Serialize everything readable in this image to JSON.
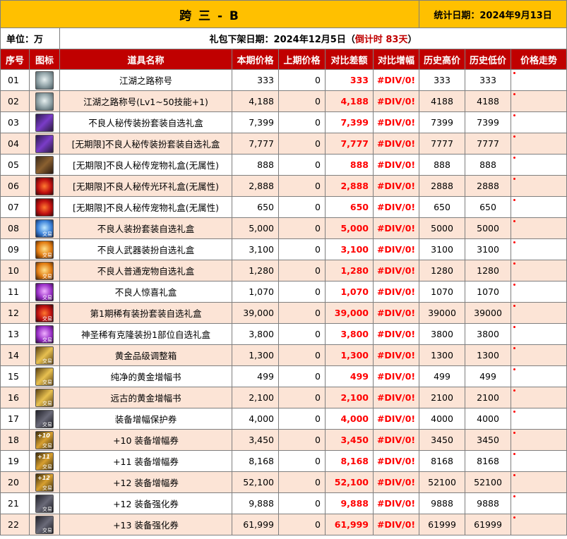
{
  "header": {
    "title": "跨 三 - B",
    "stat_date": "统计日期：2024年9月13日"
  },
  "info": {
    "unit": "单位：万",
    "offline_prefix": "礼包下架日期：2024年12月5日（",
    "countdown": "倒计时 83天",
    "offline_suffix": "）"
  },
  "columns": [
    "序号",
    "图标",
    "道具名称",
    "本期价格",
    "上期价格",
    "对比差额",
    "对比增幅",
    "历史高价",
    "历史低价",
    "价格走势"
  ],
  "rows": [
    {
      "no": "01",
      "icon": "silver-title-icon",
      "style": "ic-silver",
      "tag": "",
      "num": "",
      "name": "江湖之路称号",
      "cur": "333",
      "prev": "0",
      "diff": "333",
      "pct": "#DIV/0!",
      "hi": "333",
      "lo": "333"
    },
    {
      "no": "02",
      "icon": "silver-title-icon",
      "style": "ic-silver",
      "tag": "",
      "num": "",
      "name": "江湖之路称号(Lv1~50技能+1)",
      "cur": "4,188",
      "prev": "0",
      "diff": "4,188",
      "pct": "#DIV/0!",
      "hi": "4188",
      "lo": "4188"
    },
    {
      "no": "03",
      "icon": "purple-box-icon",
      "style": "ic-purple",
      "tag": "",
      "num": "",
      "name": "不良人秘传装扮套装自选礼盒",
      "cur": "7,399",
      "prev": "0",
      "diff": "7,399",
      "pct": "#DIV/0!",
      "hi": "7399",
      "lo": "7399"
    },
    {
      "no": "04",
      "icon": "purple-box-icon",
      "style": "ic-purple",
      "tag": "",
      "num": "",
      "name": "[无期限]不良人秘传装扮套装自选礼盒",
      "cur": "7,777",
      "prev": "0",
      "diff": "7,777",
      "pct": "#DIV/0!",
      "hi": "7777",
      "lo": "7777"
    },
    {
      "no": "05",
      "icon": "brown-box-icon",
      "style": "ic-brown",
      "tag": "",
      "num": "",
      "name": "[无期限]不良人秘传宠物礼盒(无属性)",
      "cur": "888",
      "prev": "0",
      "diff": "888",
      "pct": "#DIV/0!",
      "hi": "888",
      "lo": "888"
    },
    {
      "no": "06",
      "icon": "red-aura-icon",
      "style": "ic-red",
      "tag": "",
      "num": "",
      "name": "[无期限]不良人秘传光环礼盒(无属性)",
      "cur": "2,888",
      "prev": "0",
      "diff": "2,888",
      "pct": "#DIV/0!",
      "hi": "2888",
      "lo": "2888"
    },
    {
      "no": "07",
      "icon": "red-pet-icon",
      "style": "ic-red",
      "tag": "",
      "num": "",
      "name": "[无期限]不良人秘传宠物礼盒(无属性)",
      "cur": "650",
      "prev": "0",
      "diff": "650",
      "pct": "#DIV/0!",
      "hi": "650",
      "lo": "650"
    },
    {
      "no": "08",
      "icon": "blue-box-icon",
      "style": "ic-blue",
      "tag": "交易",
      "num": "",
      "name": "不良人装扮套装自选礼盒",
      "cur": "5,000",
      "prev": "0",
      "diff": "5,000",
      "pct": "#DIV/0!",
      "hi": "5000",
      "lo": "5000"
    },
    {
      "no": "09",
      "icon": "orange-box-icon",
      "style": "ic-orange",
      "tag": "交易",
      "num": "",
      "name": "不良人武器装扮自选礼盒",
      "cur": "3,100",
      "prev": "0",
      "diff": "3,100",
      "pct": "#DIV/0!",
      "hi": "3100",
      "lo": "3100"
    },
    {
      "no": "10",
      "icon": "orange-box-icon",
      "style": "ic-orange",
      "tag": "交易",
      "num": "",
      "name": "不良人普通宠物自选礼盒",
      "cur": "1,280",
      "prev": "0",
      "diff": "1,280",
      "pct": "#DIV/0!",
      "hi": "1280",
      "lo": "1280"
    },
    {
      "no": "11",
      "icon": "violet-box-icon",
      "style": "ic-violet",
      "tag": "交易",
      "num": "",
      "name": "不良人惊喜礼盒",
      "cur": "1,070",
      "prev": "0",
      "diff": "1,070",
      "pct": "#DIV/0!",
      "hi": "1070",
      "lo": "1070"
    },
    {
      "no": "12",
      "icon": "red-box-icon",
      "style": "ic-red",
      "tag": "交易",
      "num": "",
      "name": "第1期稀有装扮套装自选礼盒",
      "cur": "39,000",
      "prev": "0",
      "diff": "39,000",
      "pct": "#DIV/0!",
      "hi": "39000",
      "lo": "39000"
    },
    {
      "no": "13",
      "icon": "violet-box-icon",
      "style": "ic-violet",
      "tag": "交易",
      "num": "",
      "name": "神圣稀有克隆装扮1部位自选礼盒",
      "cur": "3,800",
      "prev": "0",
      "diff": "3,800",
      "pct": "#DIV/0!",
      "hi": "3800",
      "lo": "3800"
    },
    {
      "no": "14",
      "icon": "gold-box-icon",
      "style": "ic-gold",
      "tag": "交易",
      "num": "",
      "name": "黄金品级调整箱",
      "cur": "1,300",
      "prev": "0",
      "diff": "1,300",
      "pct": "#DIV/0!",
      "hi": "1300",
      "lo": "1300"
    },
    {
      "no": "15",
      "icon": "gold-book-icon",
      "style": "ic-gold",
      "tag": "交易",
      "num": "",
      "name": "纯净的黄金增幅书",
      "cur": "499",
      "prev": "0",
      "diff": "499",
      "pct": "#DIV/0!",
      "hi": "499",
      "lo": "499"
    },
    {
      "no": "16",
      "icon": "gold-book-icon",
      "style": "ic-gold",
      "tag": "交易",
      "num": "",
      "name": "远古的黄金增幅书",
      "cur": "2,100",
      "prev": "0",
      "diff": "2,100",
      "pct": "#DIV/0!",
      "hi": "2100",
      "lo": "2100"
    },
    {
      "no": "17",
      "icon": "protect-ticket-icon",
      "style": "ic-dark",
      "tag": "交易",
      "num": "",
      "name": "装备增幅保护券",
      "cur": "4,000",
      "prev": "0",
      "diff": "4,000",
      "pct": "#DIV/0!",
      "hi": "4000",
      "lo": "4000"
    },
    {
      "no": "18",
      "icon": "amplify-ticket-icon",
      "style": "ic-plus",
      "tag": "交易",
      "num": "+10",
      "name": "+10 装备增幅券",
      "cur": "3,450",
      "prev": "0",
      "diff": "3,450",
      "pct": "#DIV/0!",
      "hi": "3450",
      "lo": "3450"
    },
    {
      "no": "19",
      "icon": "amplify-ticket-icon",
      "style": "ic-plus",
      "tag": "交易",
      "num": "+11",
      "name": "+11 装备增幅券",
      "cur": "8,168",
      "prev": "0",
      "diff": "8,168",
      "pct": "#DIV/0!",
      "hi": "8168",
      "lo": "8168"
    },
    {
      "no": "20",
      "icon": "amplify-ticket-icon",
      "style": "ic-plus",
      "tag": "交易",
      "num": "+12",
      "name": "+12 装备增幅券",
      "cur": "52,100",
      "prev": "0",
      "diff": "52,100",
      "pct": "#DIV/0!",
      "hi": "52100",
      "lo": "52100"
    },
    {
      "no": "21",
      "icon": "reinforce-ticket-icon",
      "style": "ic-dark",
      "tag": "交易",
      "num": "+12",
      "name": "+12 装备强化券",
      "cur": "9,888",
      "prev": "0",
      "diff": "9,888",
      "pct": "#DIV/0!",
      "hi": "9888",
      "lo": "9888"
    },
    {
      "no": "22",
      "icon": "reinforce-ticket-icon",
      "style": "ic-dark",
      "tag": "交易",
      "num": "+13",
      "name": "+13 装备强化券",
      "cur": "61,999",
      "prev": "0",
      "diff": "61,999",
      "pct": "#DIV/0!",
      "hi": "61999",
      "lo": "61999"
    }
  ]
}
